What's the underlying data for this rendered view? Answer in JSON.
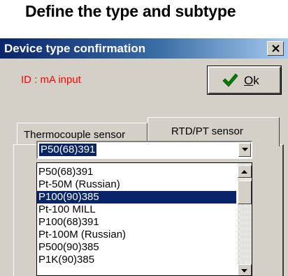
{
  "heading": "Define the type and subtype",
  "dialog": {
    "title": "Device type confirmation",
    "close_label": "X",
    "id_text": "ID : mA input",
    "ok_button": {
      "label_prefix": "O",
      "label_rest": "k",
      "icon": "checkmark-icon"
    },
    "tabs": [
      {
        "label": "Thermocouple sensor",
        "active": false
      },
      {
        "label": "RTD/PT sensor",
        "active": true
      }
    ],
    "combo": {
      "selected_value": "P50(68)391"
    },
    "list": {
      "items": [
        "P50(68)391",
        "Pt-50M (Russian)",
        "P100(90)385",
        "Pt-100 MILL",
        "P100(68)391",
        "Pt-100M (Russian)",
        "P500(90)385",
        "P1K(90)385"
      ],
      "selected_index": 2
    }
  },
  "colors": {
    "title_gradient_start": "#0a246a",
    "title_gradient_end": "#a6caf0",
    "selection": "#0a246a",
    "id_text": "#ff0000",
    "dialog_face": "#d4d0c8",
    "checkmark": "#008000"
  }
}
